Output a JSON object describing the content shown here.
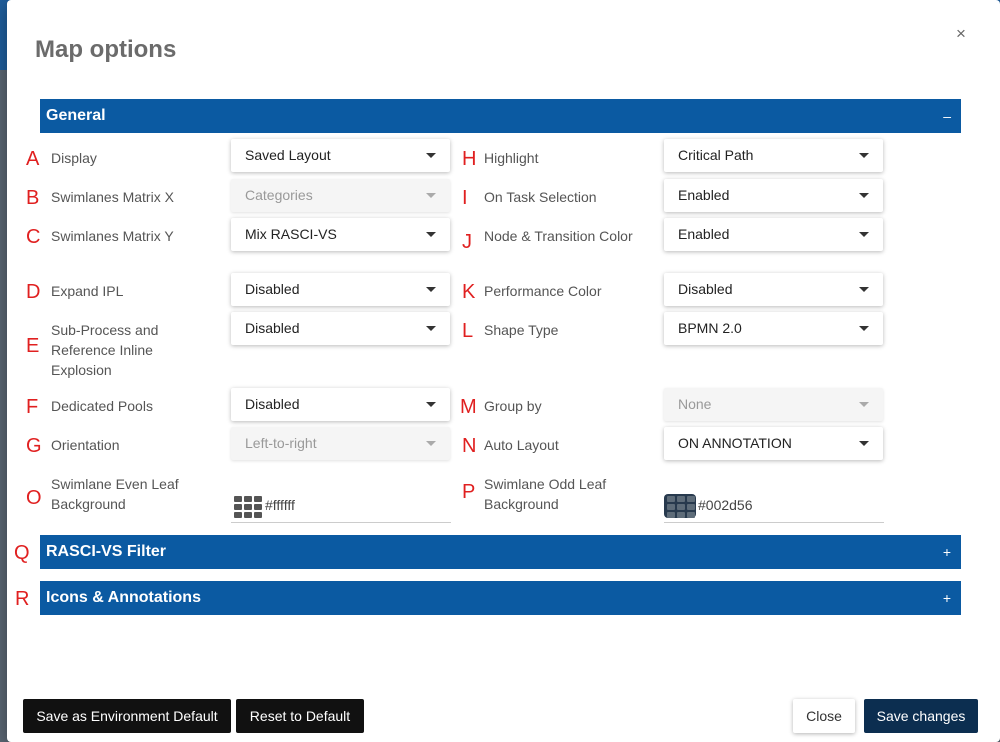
{
  "modal": {
    "title": "Map options",
    "close_icon": "×"
  },
  "sections": {
    "general": {
      "label": "General",
      "toggle": "–"
    },
    "rasci": {
      "label": "RASCI-VS Filter",
      "toggle": "+"
    },
    "icons": {
      "label": "Icons & Annotations",
      "toggle": "+"
    }
  },
  "section_letters": {
    "q": "Q",
    "r": "R"
  },
  "fields_left": [
    {
      "letter": "A",
      "label": "Display",
      "value": "Saved Layout",
      "disabled": false
    },
    {
      "letter": "B",
      "label": "Swimlanes Matrix X",
      "value": "Categories",
      "disabled": true
    },
    {
      "letter": "C",
      "label": "Swimlanes Matrix Y",
      "value": "Mix RASCI-VS",
      "disabled": false
    },
    {
      "letter": "D",
      "label": "Expand IPL",
      "value": "Disabled",
      "disabled": false
    },
    {
      "letter": "E",
      "label": "Sub-Process and Reference Inline Explosion",
      "value": "Disabled",
      "disabled": false
    },
    {
      "letter": "F",
      "label": "Dedicated Pools",
      "value": "Disabled",
      "disabled": false
    },
    {
      "letter": "G",
      "label": "Orientation",
      "value": "Left-to-right",
      "disabled": true
    }
  ],
  "fields_right": [
    {
      "letter": "H",
      "label": "Highlight",
      "value": "Critical Path",
      "disabled": false
    },
    {
      "letter": "I",
      "label": "On Task Selection",
      "value": "Enabled",
      "disabled": false
    },
    {
      "letter": "J",
      "label": "Node & Transition Color",
      "value": "Enabled",
      "disabled": false
    },
    {
      "letter": "K",
      "label": "Performance Color",
      "value": "Disabled",
      "disabled": false
    },
    {
      "letter": "L",
      "label": "Shape Type",
      "value": "BPMN 2.0",
      "disabled": false
    },
    {
      "letter": "M",
      "label": "Group by",
      "value": "None",
      "disabled": true
    },
    {
      "letter": "N",
      "label": "Auto Layout",
      "value": "ON ANNOTATION",
      "disabled": false
    }
  ],
  "color_fields": [
    {
      "letter": "O",
      "label": "Swimlane Even Leaf Background",
      "value": "#ffffff"
    },
    {
      "letter": "P",
      "label": "Swimlane Odd Leaf Background",
      "value": "#002d56"
    }
  ],
  "footer": {
    "save_env_default": "Save as Environment Default",
    "reset_default": "Reset to Default",
    "close": "Close",
    "save_changes": "Save changes"
  },
  "colors": {
    "section_header": "#0b5aa2",
    "primary_button": "#0c2e50",
    "letter_marker": "#e02020"
  }
}
